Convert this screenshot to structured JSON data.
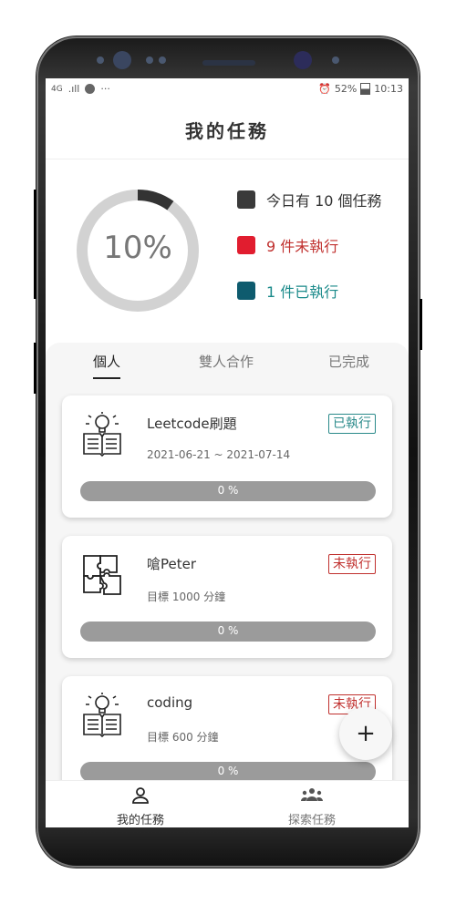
{
  "status_bar": {
    "left": [
      "4G",
      ".ıll",
      "✓",
      "···"
    ],
    "battery": "52%",
    "time": "10:13"
  },
  "header": {
    "title": "我的任務"
  },
  "summary": {
    "percent_label": "10%",
    "percent_value": 10,
    "legend": [
      {
        "label": "今日有 10 個任務",
        "color": "#3a3a3a",
        "text_color": "#333333"
      },
      {
        "label": "9 件未執行",
        "color": "#e11d2f",
        "text_color": "#c0302e"
      },
      {
        "label": "1 件已執行",
        "color": "#0e5b6e",
        "text_color": "#1a8a8a"
      }
    ]
  },
  "tabs": [
    {
      "label": "個人",
      "active": true
    },
    {
      "label": "雙人合作",
      "active": false
    },
    {
      "label": "已完成",
      "active": false
    }
  ],
  "tasks": [
    {
      "icon": "book-idea-icon",
      "title": "Leetcode刷題",
      "subtitle": "2021-06-21 ~ 2021-07-14",
      "status": "已執行",
      "status_type": "done",
      "progress_label": "0 %",
      "progress_value": 0
    },
    {
      "icon": "puzzle-icon",
      "title": "嗆Peter",
      "subtitle": "目標 1000 分鐘",
      "status": "未執行",
      "status_type": "todo",
      "progress_label": "0 %",
      "progress_value": 0
    },
    {
      "icon": "book-idea-icon",
      "title": "coding",
      "subtitle": "目標 600 分鐘",
      "status": "未執行",
      "status_type": "todo",
      "progress_label": "0 %",
      "progress_value": 0
    }
  ],
  "fab": {
    "label": "+"
  },
  "bottom_nav": [
    {
      "label": "我的任務",
      "icon": "person-icon",
      "active": true
    },
    {
      "label": "探索任務",
      "icon": "group-icon",
      "active": false
    }
  ]
}
